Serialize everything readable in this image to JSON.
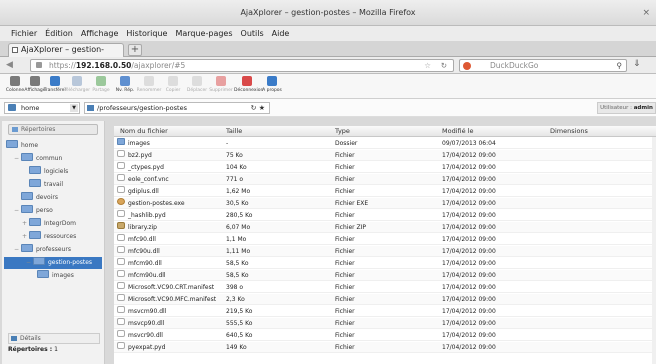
{
  "window": {
    "title": "AjaXplorer – gestion-postes – Mozilla Firefox",
    "close": "×"
  },
  "menu": [
    "Fichier",
    "Édition",
    "Affichage",
    "Historique",
    "Marque-pages",
    "Outils",
    "Aide"
  ],
  "tab": {
    "label": "AjaXplorer – gestion-postes",
    "new": "+"
  },
  "url": {
    "protocol": "https://",
    "host": "192.168.0.50",
    "path": "/ajaxplorer/#5"
  },
  "search": {
    "placeholder": "DuckDuckGo"
  },
  "toolbar": [
    {
      "label": "Colonne",
      "icon": "columns-icon",
      "color": "#7a7a7a",
      "enabled": true
    },
    {
      "label": "Affichage",
      "icon": "display-icon",
      "color": "#7a7a7a",
      "enabled": true
    },
    {
      "label": "Transférer",
      "icon": "upload-icon",
      "color": "#3a7bc8",
      "enabled": true
    },
    {
      "label": "Télécharger",
      "icon": "download-icon",
      "color": "#b8c7da",
      "enabled": false
    },
    {
      "label": "Partage",
      "icon": "share-icon",
      "color": "#9bc89b",
      "enabled": false
    },
    {
      "label": "Nv. Rép.",
      "icon": "new-folder-icon",
      "color": "#5e8fd0",
      "enabled": true
    },
    {
      "label": "Renommer",
      "icon": "rename-icon",
      "color": "#dddddd",
      "enabled": false
    },
    {
      "label": "Copier",
      "icon": "copy-icon",
      "color": "#dddddd",
      "enabled": false
    },
    {
      "label": "Déplacer",
      "icon": "move-icon",
      "color": "#dddddd",
      "enabled": false
    },
    {
      "label": "Supprimer",
      "icon": "delete-icon",
      "color": "#e8a0a0",
      "enabled": false
    },
    {
      "label": "Déconnexion",
      "icon": "logout-icon",
      "color": "#d94a4a",
      "enabled": true
    },
    {
      "label": "A propos",
      "icon": "info-icon",
      "color": "#3a7bc8",
      "enabled": true
    }
  ],
  "pathbar": {
    "workspace": "home",
    "path": "/professeurs/gestion-postes",
    "user_label": "Utilisateur : ",
    "user": "admin"
  },
  "left": {
    "header": "Répertoires",
    "details": "Détails",
    "rep_label": "Répertoires :",
    "rep_count": "1"
  },
  "tree": [
    {
      "label": "home",
      "level": 0
    },
    {
      "label": "commun",
      "level": 1,
      "exp": "−"
    },
    {
      "label": "logiciels",
      "level": 2
    },
    {
      "label": "travail",
      "level": 2
    },
    {
      "label": "devoirs",
      "level": 1
    },
    {
      "label": "perso",
      "level": 1,
      "exp": "−"
    },
    {
      "label": "IntegrDom",
      "level": 2,
      "exp": "+"
    },
    {
      "label": "ressources",
      "level": 2,
      "exp": "+"
    },
    {
      "label": "professeurs",
      "level": 1,
      "exp": "−"
    },
    {
      "label": "gestion-postes",
      "level": 2,
      "exp": "−",
      "selected": true
    },
    {
      "label": "images",
      "level": 3
    }
  ],
  "columns": [
    "Nom du fichier",
    "Taille",
    "Type",
    "Modifié le",
    "Dimensions"
  ],
  "files": [
    {
      "name": "images",
      "size": "-",
      "type": "Dossier",
      "date": "09/07/2013 06:04",
      "kind": "folder"
    },
    {
      "name": "bz2.pyd",
      "size": "75 Ko",
      "type": "Fichier",
      "date": "17/04/2012 09:00",
      "kind": "file"
    },
    {
      "name": "_ctypes.pyd",
      "size": "104 Ko",
      "type": "Fichier",
      "date": "17/04/2012 09:00",
      "kind": "file"
    },
    {
      "name": "eole_conf.vnc",
      "size": "771 o",
      "type": "Fichier",
      "date": "17/04/2012 09:00",
      "kind": "file"
    },
    {
      "name": "gdiplus.dll",
      "size": "1,62 Mo",
      "type": "Fichier",
      "date": "17/04/2012 09:00",
      "kind": "file"
    },
    {
      "name": "gestion-postes.exe",
      "size": "30,5 Ko",
      "type": "Fichier EXE",
      "date": "17/04/2012 09:00",
      "kind": "exe"
    },
    {
      "name": "_hashlib.pyd",
      "size": "280,5 Ko",
      "type": "Fichier",
      "date": "17/04/2012 09:00",
      "kind": "file"
    },
    {
      "name": "library.zip",
      "size": "6,07 Mo",
      "type": "Fichier ZIP",
      "date": "17/04/2012 09:00",
      "kind": "zip"
    },
    {
      "name": "mfc90.dll",
      "size": "1,1 Mo",
      "type": "Fichier",
      "date": "17/04/2012 09:00",
      "kind": "file"
    },
    {
      "name": "mfc90u.dll",
      "size": "1,11 Mo",
      "type": "Fichier",
      "date": "17/04/2012 09:00",
      "kind": "file"
    },
    {
      "name": "mfcm90.dll",
      "size": "58,5 Ko",
      "type": "Fichier",
      "date": "17/04/2012 09:00",
      "kind": "file"
    },
    {
      "name": "mfcm90u.dll",
      "size": "58,5 Ko",
      "type": "Fichier",
      "date": "17/04/2012 09:00",
      "kind": "file"
    },
    {
      "name": "Microsoft.VC90.CRT.manifest",
      "size": "398 o",
      "type": "Fichier",
      "date": "17/04/2012 09:00",
      "kind": "file"
    },
    {
      "name": "Microsoft.VC90.MFC.manifest",
      "size": "2,3 Ko",
      "type": "Fichier",
      "date": "17/04/2012 09:00",
      "kind": "file"
    },
    {
      "name": "msvcm90.dll",
      "size": "219,5 Ko",
      "type": "Fichier",
      "date": "17/04/2012 09:00",
      "kind": "file"
    },
    {
      "name": "msvcp90.dll",
      "size": "555,5 Ko",
      "type": "Fichier",
      "date": "17/04/2012 09:00",
      "kind": "file"
    },
    {
      "name": "msvcr90.dll",
      "size": "640,5 Ko",
      "type": "Fichier",
      "date": "17/04/2012 09:00",
      "kind": "file"
    },
    {
      "name": "pyexpat.pyd",
      "size": "149 Ko",
      "type": "Fichier",
      "date": "17/04/2012 09:00",
      "kind": "file"
    }
  ]
}
